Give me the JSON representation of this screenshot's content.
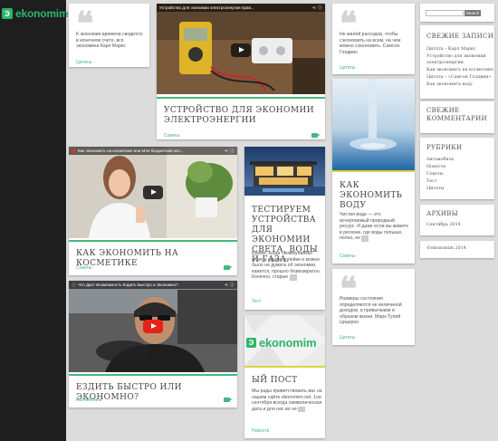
{
  "brand": {
    "logo_text": "ekonomim",
    "logo_mark": "Э"
  },
  "posts": {
    "quote1": {
      "text": "К экономии времени сводится, в конечном счете, вся экономика Карл Маркс",
      "category": "Цитаты"
    },
    "video1": {
      "video_title": "Устройство для экономии электроэнергии прав...",
      "title": "УСТРОЙСТВО ДЛЯ ЭКОНОМИИ ЭЛЕКТРОЭНЕРГИИ",
      "category": "Советы"
    },
    "quote2": {
      "text": "Не жалей расходов, чтобы сэкономить на всем, на чем можно сэкономить. Самсон Голдвин",
      "category": "Цитаты"
    },
    "water": {
      "title": "КАК ЭКОНОМИТЬ ВОДУ",
      "text": "Чистая вода — это исчерпаемый природный ресурс. И даже если вы живете в регионе, где воды попыше, полно, ее",
      "category": "Советы"
    },
    "video2": {
      "video_title": "Как экономить на косметике или Моя бюджетная кос...",
      "title": "КАК ЭКОНОМИТЬ НА КОСМЕТИКЕ",
      "category": "Советы"
    },
    "house": {
      "title": "ТЕСТИРУЕМ УСТРОЙСТВА ДЛЯ ЭКОНОМИИ СВЕТА, ВОДЫ И ГАЗА.",
      "text": "Время, когда «коммуналка» стоила сущие копейки и можно было не думать об экономии, кажется, прошло безвозвратно. Конечно, старые",
      "category": "Тест"
    },
    "video3": {
      "video_title": "Что Даст Возможность Ездить Быстро и Экономно?",
      "title": "ЕЗДИТЬ БЫСТРО ИЛИ ЭКОНОМНО?",
      "category": "Автомобиль"
    },
    "first": {
      "title": "ЫЙ ПОСТ",
      "text": "Мы рады приветствовать вас на нашем сайте ekonomim.net. 1ое сентября всегда символическая дата и для нас ио не",
      "category": "Новости"
    },
    "quote3": {
      "text": "Размеры состояния определяются не величиной доходов, а привычками и образом жизни. Марк Тулий Цицерон",
      "category": "Цитаты"
    },
    "more_label": "…"
  },
  "sidebar": {
    "search_button": "Search",
    "recent": {
      "title": "СВЕЖИЕ ЗАПИСИ",
      "items": [
        "Цитата – Карл Маркс",
        "Устройство для экономии",
        "электроэнергии",
        "Как экономить на косметике",
        "Цитата – «Самсон Голдвин»",
        "Как экономить воду"
      ]
    },
    "comments": {
      "title": "СВЕЖИЕ КОММЕНТАРИИ"
    },
    "rubrics": {
      "title": "РУБРИКИ",
      "items": [
        "Автомобиль",
        "Новости",
        "Советы",
        "Тест",
        "Цитаты"
      ]
    },
    "archives": {
      "title": "АРХИВЫ",
      "items": [
        "Сентябрь 2014"
      ]
    },
    "copyright": "©ekonomim 2014"
  },
  "colors": {
    "accent": "#41b97c",
    "sidebar_bg": "#1e1e1e",
    "page_bg": "#dcdcdc"
  }
}
